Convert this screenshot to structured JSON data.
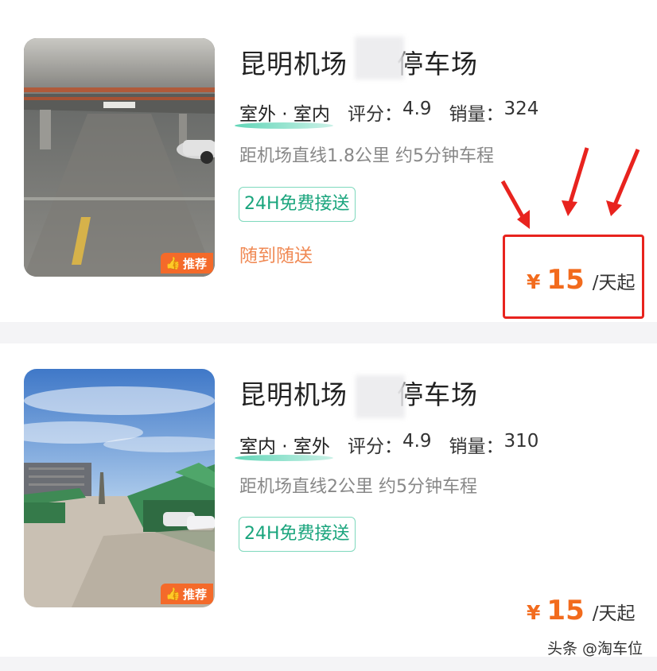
{
  "listings": [
    {
      "title": "昆明机场",
      "title_suffix": "停车场",
      "types": "室外 · 室内",
      "rating_label": "评分：",
      "rating": "4.9",
      "sales_label": "销量：",
      "sales": "324",
      "distance": "距机场直线1.8公里 约5分钟车程",
      "tag": "24H免费接送",
      "service": "随到随送",
      "badge": "推荐",
      "currency": "¥",
      "price": "15",
      "price_unit": "/天起"
    },
    {
      "title": "昆明机场",
      "title_suffix": "停车场",
      "types": "室内 · 室外",
      "rating_label": "评分：",
      "rating": "4.9",
      "sales_label": "销量：",
      "sales": "310",
      "distance": "距机场直线2公里 约5分钟车程",
      "tag": "24H免费接送",
      "badge": "推荐",
      "currency": "¥",
      "price": "15",
      "price_unit": "/天起"
    }
  ],
  "watermark": "头条 @淘车位",
  "colors": {
    "accent_price": "#f26b1d",
    "tag_green": "#1aa57d",
    "badge_orange": "#f46a2a",
    "highlight_red": "#e8231e"
  },
  "icons": {
    "badge_icon": "thumbs-up-icon",
    "annotation": "red-arrow-icon"
  }
}
